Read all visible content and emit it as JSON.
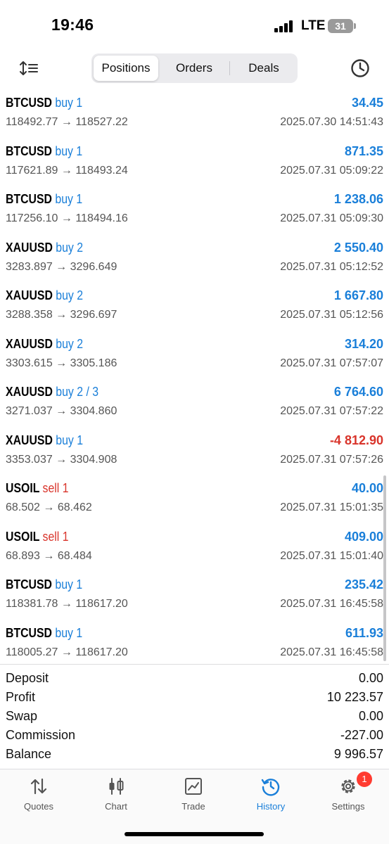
{
  "status": {
    "time": "19:46",
    "network": "LTE",
    "battery": "31"
  },
  "header": {
    "tabs": [
      {
        "label": "Positions",
        "active": true
      },
      {
        "label": "Orders",
        "active": false
      },
      {
        "label": "Deals",
        "active": false
      }
    ],
    "sort_icon": "sort-icon",
    "history_icon": "clock-icon"
  },
  "positions": [
    {
      "symbol": "BTCUSD",
      "side": "buy 1",
      "type": "buy",
      "prices": "118492.77 → 118527.22",
      "profit": "34.45",
      "datetime": "2025.07.30 14:51:43"
    },
    {
      "symbol": "BTCUSD",
      "side": "buy 1",
      "type": "buy",
      "prices": "117621.89 → 118493.24",
      "profit": "871.35",
      "datetime": "2025.07.31 05:09:22"
    },
    {
      "symbol": "BTCUSD",
      "side": "buy 1",
      "type": "buy",
      "prices": "117256.10 → 118494.16",
      "profit": "1 238.06",
      "datetime": "2025.07.31 05:09:30"
    },
    {
      "symbol": "XAUUSD",
      "side": "buy 2",
      "type": "buy",
      "prices": "3283.897 → 3296.649",
      "profit": "2 550.40",
      "datetime": "2025.07.31 05:12:52"
    },
    {
      "symbol": "XAUUSD",
      "side": "buy 2",
      "type": "buy",
      "prices": "3288.358 → 3296.697",
      "profit": "1 667.80",
      "datetime": "2025.07.31 05:12:56"
    },
    {
      "symbol": "XAUUSD",
      "side": "buy 2",
      "type": "buy",
      "prices": "3303.615 → 3305.186",
      "profit": "314.20",
      "datetime": "2025.07.31 07:57:07"
    },
    {
      "symbol": "XAUUSD",
      "side": "buy 2 / 3",
      "type": "buy",
      "prices": "3271.037 → 3304.860",
      "profit": "6 764.60",
      "datetime": "2025.07.31 07:57:22"
    },
    {
      "symbol": "XAUUSD",
      "side": "buy 1",
      "type": "buy",
      "prices": "3353.037 → 3304.908",
      "profit": "-4 812.90",
      "datetime": "2025.07.31 07:57:26"
    },
    {
      "symbol": "USOIL",
      "side": "sell 1",
      "type": "sell",
      "prices": "68.502 → 68.462",
      "profit": "40.00",
      "datetime": "2025.07.31 15:01:35"
    },
    {
      "symbol": "USOIL",
      "side": "sell 1",
      "type": "sell",
      "prices": "68.893 → 68.484",
      "profit": "409.00",
      "datetime": "2025.07.31 15:01:40"
    },
    {
      "symbol": "BTCUSD",
      "side": "buy 1",
      "type": "buy",
      "prices": "118381.78 → 118617.20",
      "profit": "235.42",
      "datetime": "2025.07.31 16:45:58"
    },
    {
      "symbol": "BTCUSD",
      "side": "buy 1",
      "type": "buy",
      "prices": "118005.27 → 118617.20",
      "profit": "611.93",
      "datetime": "2025.07.31 16:45:58"
    }
  ],
  "summary": [
    {
      "label": "Deposit",
      "value": "0.00"
    },
    {
      "label": "Profit",
      "value": "10 223.57"
    },
    {
      "label": "Swap",
      "value": "0.00"
    },
    {
      "label": "Commission",
      "value": "-227.00"
    },
    {
      "label": "Balance",
      "value": "9 996.57"
    }
  ],
  "tabbar": [
    {
      "label": "Quotes",
      "icon": "quotes-icon",
      "active": false
    },
    {
      "label": "Chart",
      "icon": "candlestick-chart-icon",
      "active": false
    },
    {
      "label": "Trade",
      "icon": "trade-chart-icon",
      "active": false
    },
    {
      "label": "History",
      "icon": "history-icon",
      "active": true
    },
    {
      "label": "Settings",
      "icon": "gear-icon",
      "active": false,
      "badge": "1"
    }
  ],
  "colors": {
    "accent": "#1a7fd9",
    "negative": "#d9342b",
    "text": "#111111",
    "secondary": "#555555"
  }
}
